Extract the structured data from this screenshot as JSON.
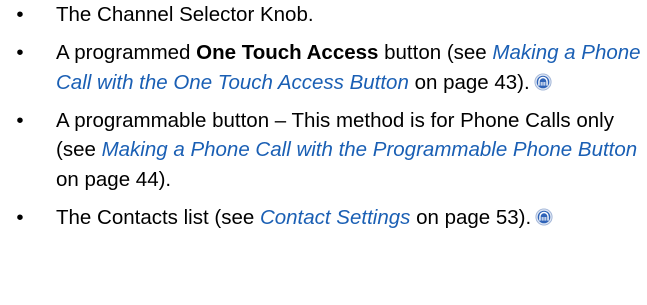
{
  "bullet_char": "•",
  "items": [
    {
      "text": "The Channel Selector Knob."
    },
    {
      "prefix": "A programmed ",
      "bold": "One Touch Access",
      "middle": " button (see ",
      "link": "Making a Phone Call with the One Touch Access Button",
      "suffix": " on page 43).",
      "badge_icon": "feature-badge-icon"
    },
    {
      "prefix": "A programmable button – This method is for Phone Calls only (see ",
      "link": "Making a Phone Call with the Programmable Phone Button",
      "suffix": " on page 44)."
    },
    {
      "prefix": "The Contacts list (see ",
      "link": "Contact Settings",
      "suffix": " on page 53).",
      "badge_icon": "feature-badge-icon"
    }
  ],
  "colors": {
    "link": "#1a5fb4",
    "badge_fill": "#2f63b8",
    "badge_ring": "#dfe7f4"
  }
}
